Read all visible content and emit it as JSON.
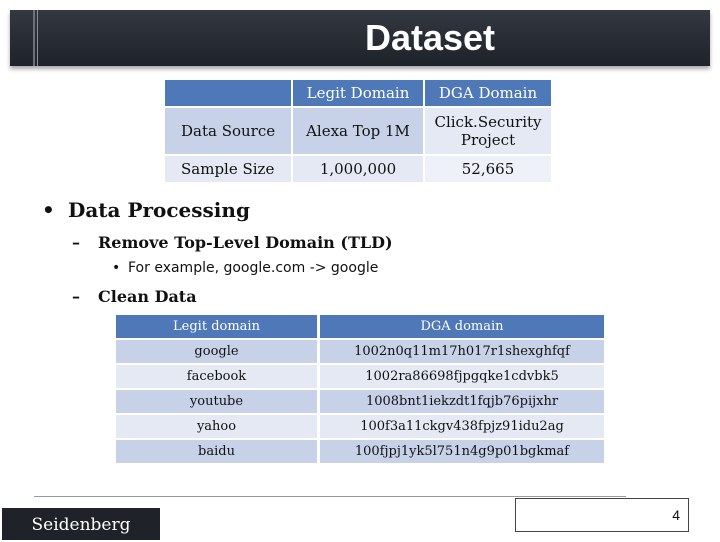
{
  "title": "Dataset",
  "dataset_table": {
    "headers": [
      "",
      "Legit Domain",
      "DGA Domain"
    ],
    "rows": [
      {
        "label": "Data Source",
        "legit": "Alexa Top 1M",
        "dga_line1": "Click.Security",
        "dga_line2": "Project"
      },
      {
        "label": "Sample Size",
        "legit": "1,000,000",
        "dga": "52,665"
      }
    ]
  },
  "bullets": {
    "processing": "Data Processing",
    "remove_tld": "Remove Top-Level Domain (TLD)",
    "example": "For example, google.com -> google",
    "clean": "Clean Data"
  },
  "domain_table": {
    "headers": [
      "Legit domain",
      "DGA domain"
    ],
    "rows": [
      [
        "google",
        "1002n0q11m17h017r1shexghfqf"
      ],
      [
        "facebook",
        "1002ra86698fjpgqke1cdvbk5"
      ],
      [
        "youtube",
        "1008bnt1iekzdt1fqjb76pijxhr"
      ],
      [
        "yahoo",
        "100f3a11ckgv438fpjz91idu2ag"
      ],
      [
        "baidu",
        "100fjpj1yk5l751n4g9p01bgkmaf"
      ]
    ]
  },
  "footer": {
    "brand": "Seidenberg",
    "page": "4"
  }
}
